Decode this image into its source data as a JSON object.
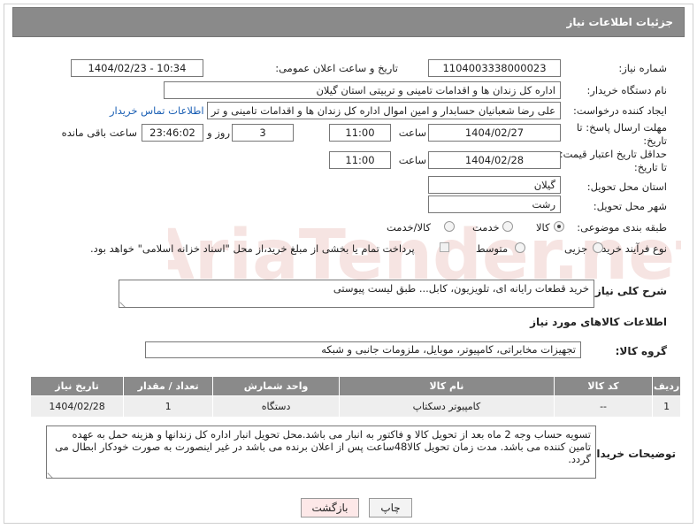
{
  "header": {
    "title": "جزئیات اطلاعات نیاز"
  },
  "fields": {
    "need_number_label": "شماره نیاز:",
    "need_number": "1104003338000023",
    "announce_label": "تاریخ و ساعت اعلان عمومی:",
    "announce_value": "1404/02/23 - 10:34",
    "buyer_org_label": "نام دستگاه خریدار:",
    "buyer_org": "اداره کل زندان ها و اقدامات تامینی و تربیتی استان گیلان",
    "creator_label": "ایجاد کننده درخواست:",
    "creator": "علی رضا شعبانیان حسابدار و امین اموال اداره کل زندان ها و اقدامات تامینی و تر",
    "contact_link": "اطلاعات تماس خریدار",
    "deadline_label_1": "مهلت ارسال پاسخ: تا",
    "deadline_label_2": "تاریخ:",
    "deadline_date": "1404/02/27",
    "time_label": "ساعت",
    "deadline_time": "11:00",
    "days_value": "3",
    "days_label": "روز و",
    "remaining_time": "23:46:02",
    "remaining_label": "ساعت باقی مانده",
    "validity_label_1": "حداقل تاریخ اعتبار قیمت:",
    "validity_label_2": "تا تاریخ:",
    "validity_date": "1404/02/28",
    "validity_time": "11:00",
    "province_label": "استان محل تحویل:",
    "province": "گیلان",
    "city_label": "شهر محل تحویل:",
    "city": "رشت",
    "category_label": "طبقه بندی موضوعی:",
    "category_options": [
      "کالا",
      "خدمت",
      "کالا/خدمت"
    ],
    "purchase_type_label": "نوع فرآیند خرید :",
    "purchase_type_options": [
      "جزیی",
      "متوسط"
    ],
    "payment_note": "پرداخت تمام یا بخشی از مبلغ خرید،از محل \"اسناد خزانه اسلامی\" خواهد بود.",
    "description_label": "شرح کلی نیاز:",
    "description": "خرید قطعات رایانه ای، تلویزیون، کابل... طبق لیست پیوستی"
  },
  "goods_section": {
    "title": "اطلاعات کالاهای مورد نیاز",
    "group_label": "گروه کالا:",
    "group_value": "تجهیزات مخابراتی، کامپیوتر، موبایل، ملزومات جانبی و شبکه"
  },
  "table": {
    "headers": [
      "ردیف",
      "کد کالا",
      "نام کالا",
      "واحد شمارش",
      "تعداد / مقدار",
      "تاریخ نیاز"
    ],
    "rows": [
      [
        "1",
        "--",
        "کامپیوتر دسکتاپ",
        "دستگاه",
        "1",
        "1404/02/28"
      ]
    ]
  },
  "buyer_notes": {
    "label": "توضیحات خریدار:",
    "text": "تسویه حساب وجه 2 ماه بعد از تحویل کالا و فاکتور به انبار می باشد.محل تحویل انبار اداره کل زندانها و هزینه حمل به عهده تامین کننده می باشد. مدت زمان تحویل کالا48ساعت پس از اعلان برنده می باشد در غیر اینصورت به صورت خودکار ابطال می گردد."
  },
  "buttons": {
    "print": "چاپ",
    "back": "بازگشت"
  },
  "watermark": {
    "text": "AriaTender.net",
    "color": "#c0392b"
  }
}
